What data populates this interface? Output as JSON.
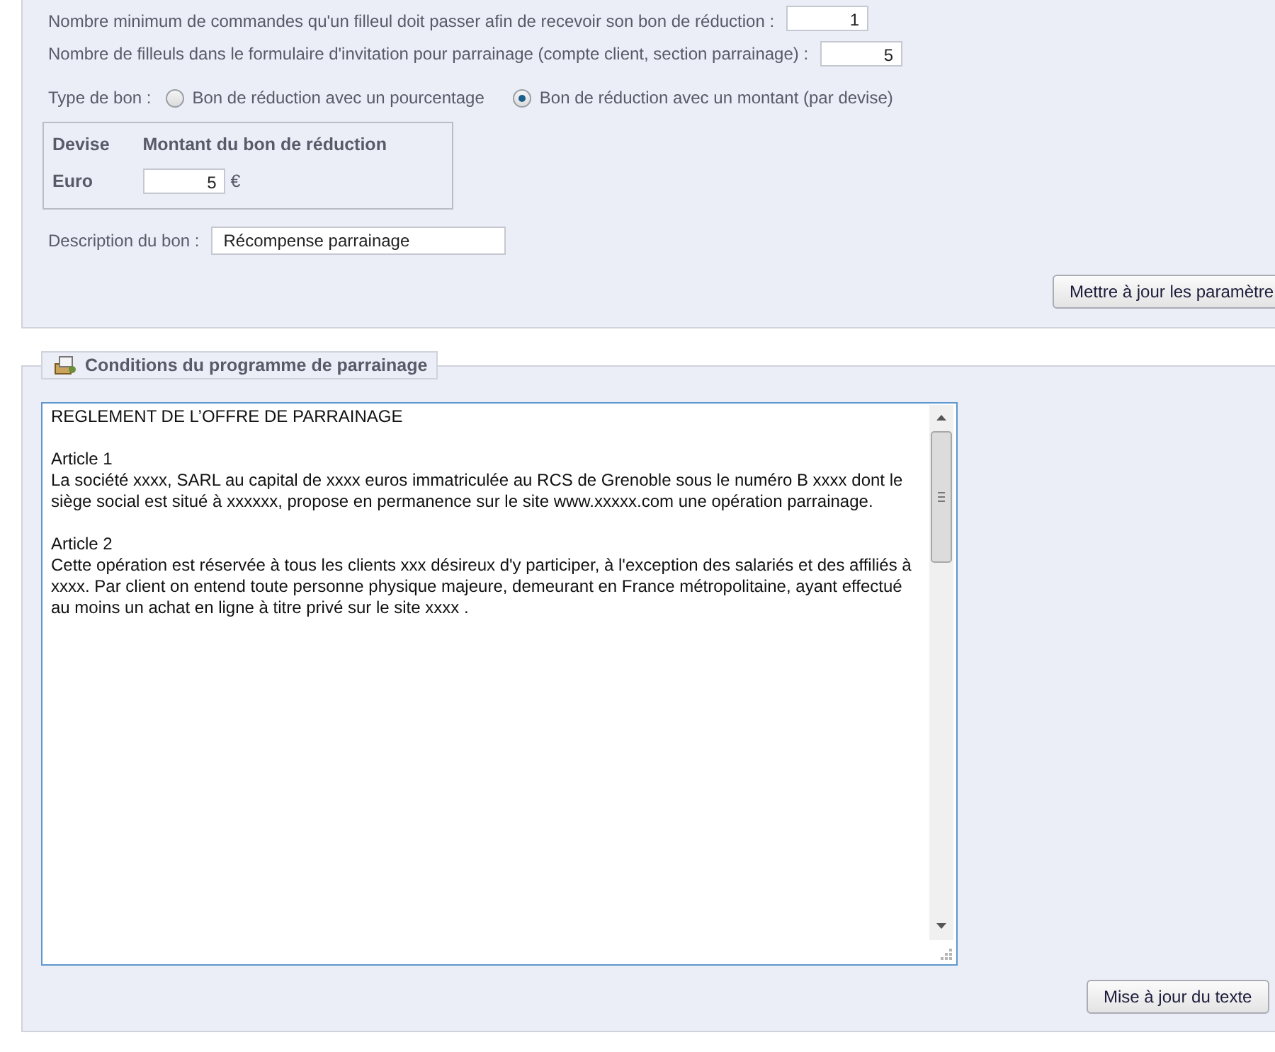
{
  "settings": {
    "fields": [
      {
        "label": "Nombre minimum de commandes qu'un filleul doit passer afin de recevoir son bon de réduction :",
        "value": "1"
      },
      {
        "label": "Nombre de filleuls dans le formulaire d'invitation pour parrainage (compte client, section parrainage) :",
        "value": "5"
      }
    ],
    "voucher_type": {
      "label": "Type de bon :",
      "options": [
        {
          "label": "Bon de réduction avec un pourcentage",
          "selected": false
        },
        {
          "label": "Bon de réduction avec un montant (par devise)",
          "selected": true
        }
      ]
    },
    "currency_table": {
      "columns": [
        "Devise",
        "Montant du bon de réduction"
      ],
      "rows": [
        {
          "currency": "Euro",
          "amount": "5",
          "symbol": "€"
        }
      ]
    },
    "description": {
      "label": "Description du bon :",
      "value": "Récompense parrainage"
    },
    "button": "Mettre à jour les paramètre"
  },
  "conditions": {
    "legend": "Conditions du programme de parrainage",
    "paragraphs": [
      "REGLEMENT DE L’OFFRE DE PARRAINAGE",
      "Article 1\nLa société xxxx, SARL au capital de xxxx euros immatriculée au RCS de Grenoble sous le numéro B xxxx dont le siège social est situé à xxxxxx, propose en permanence sur le site www.xxxxx.com une opération parrainage.",
      "Article 2\nCette opération est réservée à tous les clients xxx désireux d'y participer, à l'exception des salariés et des affiliés à xxxx. Par client on entend toute personne physique majeure, demeurant en France métropolitaine, ayant effectué au moins un achat en ligne à titre privé sur le site xxxx ."
    ],
    "button": "Mise à jour du texte"
  }
}
